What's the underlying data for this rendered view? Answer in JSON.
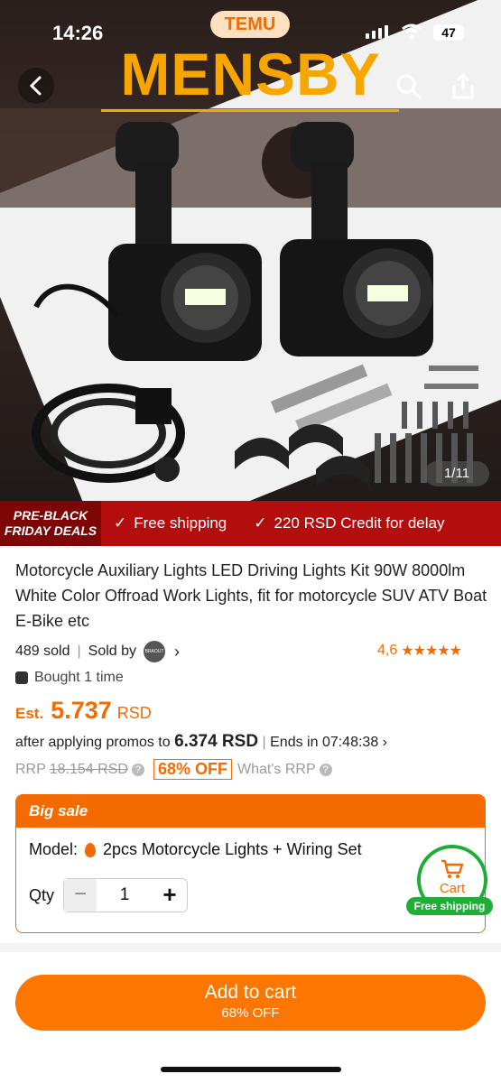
{
  "status_bar": {
    "time": "14:26",
    "battery": "47"
  },
  "header": {
    "store_badge": "TEMU",
    "brand": "MENSBY"
  },
  "gallery": {
    "counter": "1/11"
  },
  "promo": {
    "tag_line1": "PRE-BLACK",
    "tag_line2": "FRIDAY DEALS",
    "free_shipping": "Free shipping",
    "credit": "220 RSD Credit for delay"
  },
  "product": {
    "title": "Motorcycle Auxiliary Lights LED Driving Lights Kit 90W 8000lm White Color Offroad Work Lights, fit for motorcycle SUV ATV Boat E-Bike etc",
    "sold": "489 sold",
    "sold_by": "Sold by",
    "seller_logo_text": "BRAOUT",
    "rating": "4,6",
    "rating_value": 4.6,
    "bought": "Bought 1 time",
    "est_label": "Est.",
    "price": "5.737",
    "currency": "RSD",
    "after_text": "after applying promos to",
    "after_price": "6.374 RSD",
    "ends_text": "Ends in 07:48:38",
    "rrp_label": "RRP",
    "rrp_value": "18.154 RSD",
    "off": "68% OFF",
    "whats_rrp": "What's RRP"
  },
  "sale": {
    "heading": "Big sale",
    "model_label": "Model:",
    "model_value": "2pcs Motorcycle Lights + Wiring Set",
    "qty_label": "Qty",
    "qty_value": "1"
  },
  "cart_fab": {
    "label": "Cart",
    "free_tag": "Free shipping"
  },
  "cta": {
    "label": "Add to cart",
    "sub": "68% OFF"
  },
  "colors": {
    "accent": "#fb7701",
    "promo_red": "#b40d0d",
    "green": "#1fad38",
    "brand_yellow": "#f7a600"
  },
  "icons": [
    "back-icon",
    "search-icon",
    "share-icon",
    "check-icon",
    "star-icon",
    "bag-icon",
    "drop-icon",
    "cart-icon",
    "question-icon",
    "chevron-right-icon"
  ]
}
